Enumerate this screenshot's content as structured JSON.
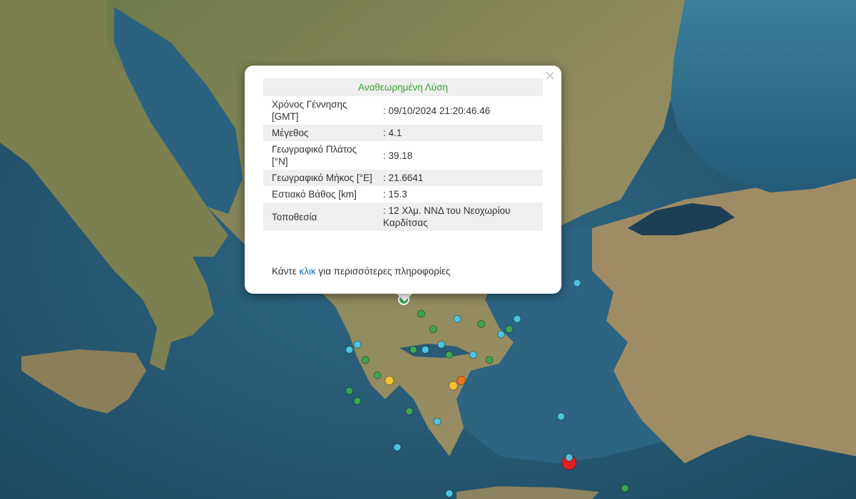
{
  "map": {
    "colors": {
      "sea": "#2d5f7a",
      "land": "#8a8a5a",
      "marker_green": "#3aa652",
      "marker_cyan": "#4cc5df",
      "marker_yellow": "#f1c231",
      "marker_orange": "#e8741e",
      "marker_red": "#e02020"
    },
    "earthquakes": [
      {
        "lat": 39.18,
        "lon": 21.66,
        "magnitude_class": "green",
        "selected": true
      },
      {
        "lat": 38.9,
        "lon": 22.1,
        "magnitude_class": "green"
      },
      {
        "lat": 38.8,
        "lon": 23.0,
        "magnitude_class": "cyan"
      },
      {
        "lat": 38.7,
        "lon": 23.6,
        "magnitude_class": "green"
      },
      {
        "lat": 38.6,
        "lon": 22.4,
        "magnitude_class": "green"
      },
      {
        "lat": 38.3,
        "lon": 22.6,
        "magnitude_class": "cyan"
      },
      {
        "lat": 38.2,
        "lon": 22.2,
        "magnitude_class": "cyan"
      },
      {
        "lat": 38.2,
        "lon": 21.9,
        "magnitude_class": "green"
      },
      {
        "lat": 38.1,
        "lon": 22.8,
        "magnitude_class": "green"
      },
      {
        "lat": 38.1,
        "lon": 23.4,
        "magnitude_class": "cyan"
      },
      {
        "lat": 38.0,
        "lon": 23.8,
        "magnitude_class": "green"
      },
      {
        "lat": 38.3,
        "lon": 20.5,
        "magnitude_class": "cyan"
      },
      {
        "lat": 38.2,
        "lon": 20.3,
        "magnitude_class": "cyan"
      },
      {
        "lat": 38.0,
        "lon": 20.7,
        "magnitude_class": "green"
      },
      {
        "lat": 37.7,
        "lon": 21.0,
        "magnitude_class": "green"
      },
      {
        "lat": 37.6,
        "lon": 21.3,
        "magnitude_class": "yellow"
      },
      {
        "lat": 37.6,
        "lon": 23.1,
        "magnitude_class": "orange"
      },
      {
        "lat": 37.5,
        "lon": 22.9,
        "magnitude_class": "yellow"
      },
      {
        "lat": 37.4,
        "lon": 20.3,
        "magnitude_class": "green"
      },
      {
        "lat": 37.2,
        "lon": 20.5,
        "magnitude_class": "green"
      },
      {
        "lat": 37.0,
        "lon": 21.8,
        "magnitude_class": "green"
      },
      {
        "lat": 36.8,
        "lon": 22.5,
        "magnitude_class": "cyan"
      },
      {
        "lat": 36.3,
        "lon": 21.5,
        "magnitude_class": "cyan"
      },
      {
        "lat": 36.0,
        "lon": 25.8,
        "magnitude_class": "red"
      },
      {
        "lat": 36.1,
        "lon": 25.8,
        "magnitude_class": "cyan"
      },
      {
        "lat": 36.9,
        "lon": 25.6,
        "magnitude_class": "cyan"
      },
      {
        "lat": 39.5,
        "lon": 26.0,
        "magnitude_class": "cyan"
      },
      {
        "lat": 38.8,
        "lon": 24.5,
        "magnitude_class": "cyan"
      },
      {
        "lat": 38.6,
        "lon": 24.3,
        "magnitude_class": "green"
      },
      {
        "lat": 35.5,
        "lon": 27.2,
        "magnitude_class": "green"
      },
      {
        "lat": 35.4,
        "lon": 22.8,
        "magnitude_class": "cyan"
      },
      {
        "lat": 38.5,
        "lon": 24.1,
        "magnitude_class": "cyan"
      }
    ]
  },
  "popup": {
    "close_glyph": "×",
    "title": "Αναθεωρημένη Λύση",
    "rows": [
      {
        "label": "Χρόνος Γέννησης [GMT]",
        "value": ": 09/10/2024 21:20:46.46"
      },
      {
        "label": "Μέγεθος",
        "value": ": 4.1"
      },
      {
        "label": "Γεωγραφικό Πλάτος [°N]",
        "value": ": 39.18"
      },
      {
        "label": "Γεωγραφικό Μήκος [°E]",
        "value": ": 21.6641"
      },
      {
        "label": "Εστιακό Βάθος [km]",
        "value": ": 15.3"
      },
      {
        "label": "Τοποθεσία",
        "value": ": 12 Χλμ. ΝΝΔ του Νεοχωρίου Καρδίτσας"
      }
    ],
    "footer_before": "Κάντε ",
    "footer_link": "κλικ",
    "footer_after": " για περισσότερες πληροφορίες"
  }
}
